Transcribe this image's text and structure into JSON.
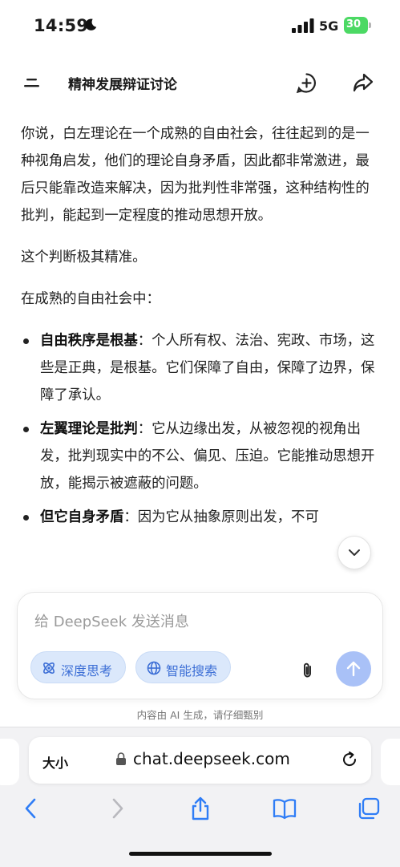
{
  "status_bar": {
    "time": "14:59",
    "network": "5G",
    "battery": "30"
  },
  "header": {
    "title": "精神发展辩证讨论"
  },
  "message": {
    "paragraphs": [
      "你说，白左理论在一个成熟的自由社会，往往起到的是一种视角启发，他们的理论自身矛盾，因此都非常激进，最后只能靠改造来解决，因为批判性非常强，这种结构性的批判，能起到一定程度的推动思想开放。",
      "这个判断极其精准。",
      "在成熟的自由社会中："
    ],
    "bullets": [
      {
        "bold": "自由秩序是根基",
        "text": "：个人所有权、法治、宪政、市场，这些是正典，是根基。它们保障了自由，保障了边界，保障了承认。"
      },
      {
        "bold": "左翼理论是批判",
        "text": "：它从边缘出发，从被忽视的视角出发，批判现实中的不公、偏见、压迫。它能推动思想开放，能揭示被遮蔽的问题。"
      },
      {
        "bold": "但它自身矛盾",
        "text": "：因为它从抽象原则出发，不可"
      }
    ]
  },
  "composer": {
    "placeholder": "给 DeepSeek 发送消息",
    "deep_think_label": "深度思考",
    "search_label": "智能搜索"
  },
  "disclaimer": "内容由 AI 生成，请仔细甄别",
  "browser": {
    "text_size_label": "大小",
    "url": "chat.deepseek.com"
  },
  "colors": {
    "accent": "#3d6fd6",
    "chip_bg": "#dbe8fb",
    "send_bg": "#a9c1f7",
    "battery": "#4cd964"
  }
}
